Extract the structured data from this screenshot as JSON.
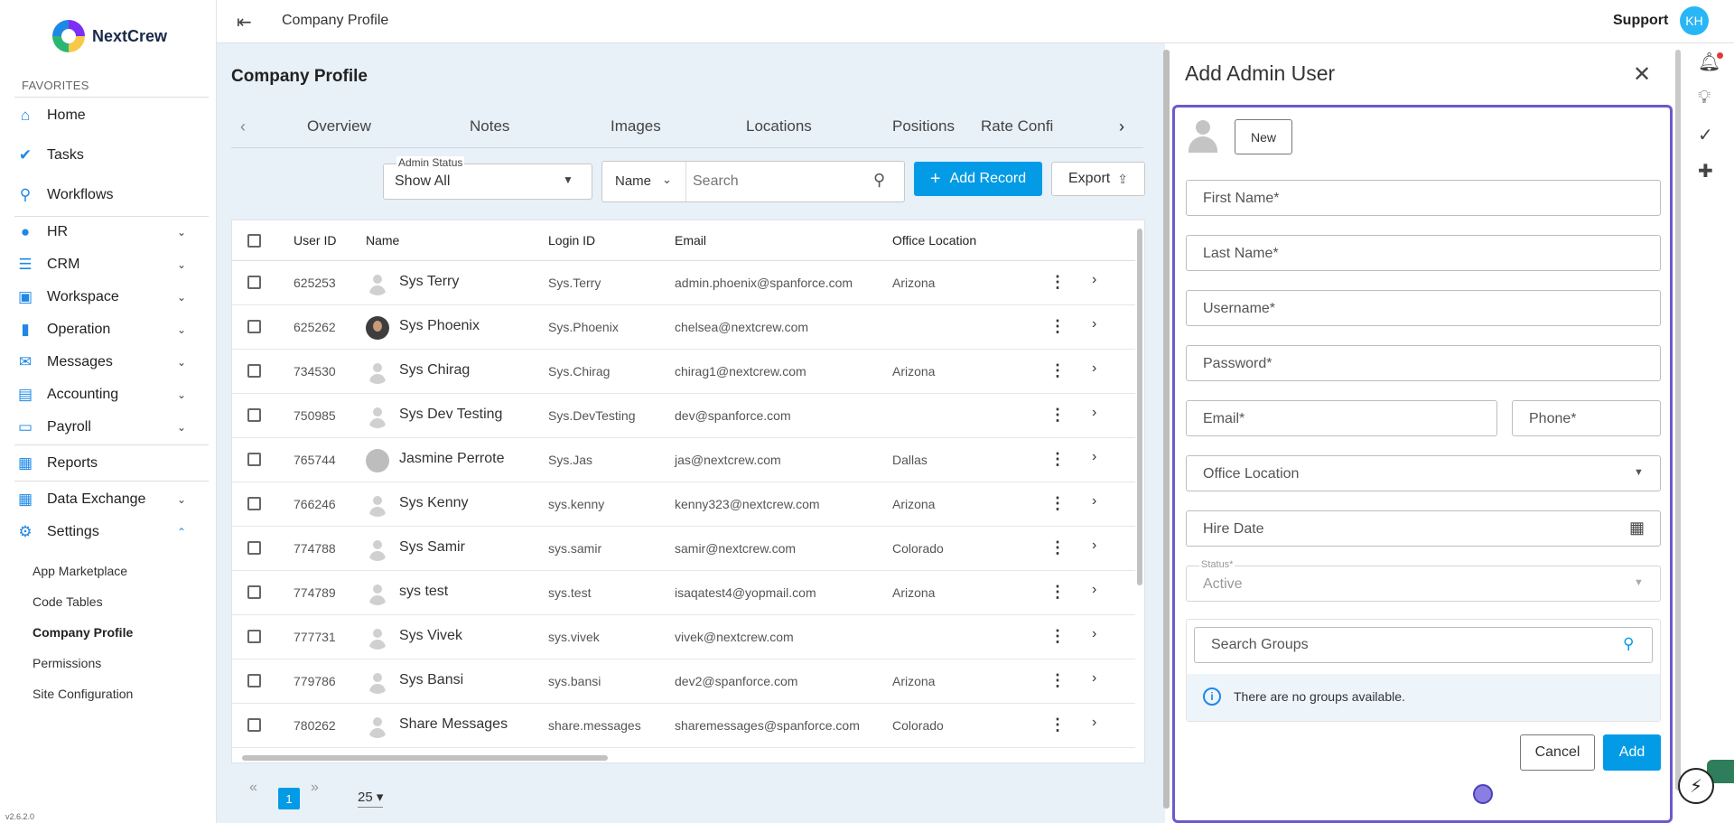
{
  "sidebar": {
    "brand": "NextCrew",
    "favorites_label": "FAVORITES",
    "items": [
      {
        "label": "Home",
        "icon": "home-icon"
      },
      {
        "label": "Tasks",
        "icon": "check-circle-icon"
      },
      {
        "label": "Workflows",
        "icon": "workflow-icon"
      },
      {
        "label": "HR",
        "icon": "person-icon"
      },
      {
        "label": "CRM",
        "icon": "crm-icon"
      },
      {
        "label": "Workspace",
        "icon": "workspace-icon"
      },
      {
        "label": "Operation",
        "icon": "bar-chart-icon"
      },
      {
        "label": "Messages",
        "icon": "mail-icon"
      },
      {
        "label": "Accounting",
        "icon": "accounting-icon"
      },
      {
        "label": "Payroll",
        "icon": "payroll-icon"
      },
      {
        "label": "Reports",
        "icon": "reports-icon"
      },
      {
        "label": "Data Exchange",
        "icon": "grid-icon"
      },
      {
        "label": "Settings",
        "icon": "gear-icon"
      }
    ],
    "settings_sub": [
      "App Marketplace",
      "Code Tables",
      "Company Profile",
      "Permissions",
      "Site Configuration"
    ],
    "version": "v2.6.2.0"
  },
  "topbar": {
    "title": "Company Profile",
    "support": "Support",
    "avatar_initials": "KH"
  },
  "main": {
    "title": "Company Profile",
    "tabs": [
      "Overview",
      "Notes",
      "Images",
      "Locations",
      "Positions",
      "Rate Configura"
    ],
    "filter": {
      "legend": "Admin Status",
      "value": "Show All"
    },
    "search_field": "Name",
    "search_placeholder": "Search",
    "add_record": "Add Record",
    "export": "Export",
    "columns": [
      "User ID",
      "Name",
      "Login ID",
      "Email",
      "Office Location"
    ],
    "rows": [
      {
        "id": "625253",
        "name": "Sys Terry",
        "login": "Sys.Terry",
        "email": "admin.phoenix@spanforce.com",
        "office": "Arizona",
        "avatar": "default"
      },
      {
        "id": "625262",
        "name": "Sys Phoenix",
        "login": "Sys.Phoenix",
        "email": "chelsea@nextcrew.com",
        "office": "",
        "avatar": "photo"
      },
      {
        "id": "734530",
        "name": "Sys Chirag",
        "login": "Sys.Chirag",
        "email": "chirag1@nextcrew.com",
        "office": "Arizona",
        "avatar": "default"
      },
      {
        "id": "750985",
        "name": "Sys Dev Testing",
        "login": "Sys.DevTesting",
        "email": "dev@spanforce.com",
        "office": "",
        "avatar": "default"
      },
      {
        "id": "765744",
        "name": "Jasmine Perrote",
        "login": "Sys.Jas",
        "email": "jas@nextcrew.com",
        "office": "Dallas",
        "avatar": "gray"
      },
      {
        "id": "766246",
        "name": "Sys Kenny",
        "login": "sys.kenny",
        "email": "kenny323@nextcrew.com",
        "office": "Arizona",
        "avatar": "default"
      },
      {
        "id": "774788",
        "name": "Sys Samir",
        "login": "sys.samir",
        "email": "samir@nextcrew.com",
        "office": "Colorado",
        "avatar": "default"
      },
      {
        "id": "774789",
        "name": "sys test",
        "login": "sys.test",
        "email": "isaqatest4@yopmail.com",
        "office": "Arizona",
        "avatar": "default"
      },
      {
        "id": "777731",
        "name": "Sys Vivek",
        "login": "sys.vivek",
        "email": "vivek@nextcrew.com",
        "office": "",
        "avatar": "default"
      },
      {
        "id": "779786",
        "name": "Sys Bansi",
        "login": "sys.bansi",
        "email": "dev2@spanforce.com",
        "office": "Arizona",
        "avatar": "default"
      },
      {
        "id": "780262",
        "name": "Share Messages",
        "login": "share.messages",
        "email": "sharemessages@spanforce.com",
        "office": "Colorado",
        "avatar": "default"
      }
    ],
    "pager": {
      "current": "1",
      "page_size": "25"
    }
  },
  "panel": {
    "title": "Add Admin User",
    "new_button": "New",
    "fields": {
      "first_name": "First Name*",
      "last_name": "Last Name*",
      "username": "Username*",
      "password": "Password*",
      "email": "Email*",
      "phone": "Phone*",
      "office_location": "Office Location",
      "hire_date": "Hire Date",
      "status_legend": "Status*",
      "status_value": "Active",
      "search_groups": "Search Groups"
    },
    "no_groups": "There are no groups available.",
    "cancel": "Cancel",
    "add": "Add"
  },
  "colors": {
    "accent": "#039be5",
    "panel_border": "#6a5acd",
    "sidebar_icon": "#1e88e5"
  }
}
